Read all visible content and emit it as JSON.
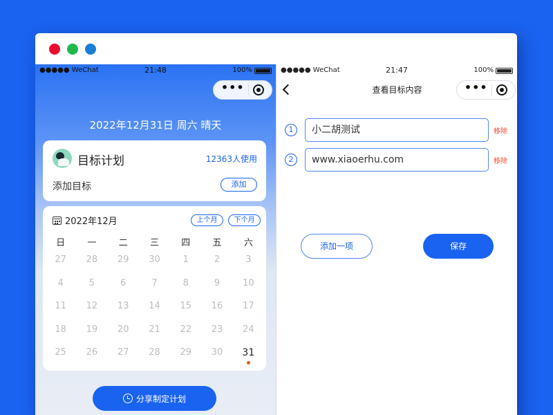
{
  "window": {
    "controls": [
      "close",
      "minimize",
      "maximize"
    ]
  },
  "left_phone": {
    "status": {
      "signal": "●●●●● WeChat",
      "time": "21:48",
      "battery": "100%"
    },
    "date_line": "2022年12月31日 周六 晴天",
    "goal_card": {
      "title": "目标计划",
      "users": "12363人使用",
      "add_label": "添加目标",
      "add_button": "添加"
    },
    "calendar": {
      "month_title": "2022年12月",
      "prev_month": "上个月",
      "next_month": "下个月",
      "weekdays": [
        "日",
        "一",
        "二",
        "三",
        "四",
        "五",
        "六"
      ],
      "weeks": [
        [
          "27",
          "28",
          "29",
          "30",
          "1",
          "2",
          "3"
        ],
        [
          "4",
          "5",
          "6",
          "7",
          "8",
          "9",
          "10"
        ],
        [
          "11",
          "12",
          "13",
          "14",
          "15",
          "16",
          "17"
        ],
        [
          "18",
          "19",
          "20",
          "21",
          "22",
          "23",
          "24"
        ],
        [
          "25",
          "26",
          "27",
          "28",
          "29",
          "30",
          "31"
        ]
      ],
      "today": "31"
    },
    "share_button": "分享制定计划"
  },
  "right_phone": {
    "status": {
      "signal": "●●●●● WeChat",
      "time": "21:47",
      "battery": "100%"
    },
    "nav_title": "查看目标内容",
    "items": [
      {
        "num": "1",
        "value": "小二胡测试",
        "remove": "移除"
      },
      {
        "num": "2",
        "value": "www.xiaoerhu.com",
        "remove": "移除"
      }
    ],
    "add_item_button": "添加一项",
    "save_button": "保存"
  },
  "colors": {
    "background": "#1a63f0",
    "accent": "#1a63f0",
    "remove": "#f04a2a",
    "today_dot": "#e85a1a"
  }
}
